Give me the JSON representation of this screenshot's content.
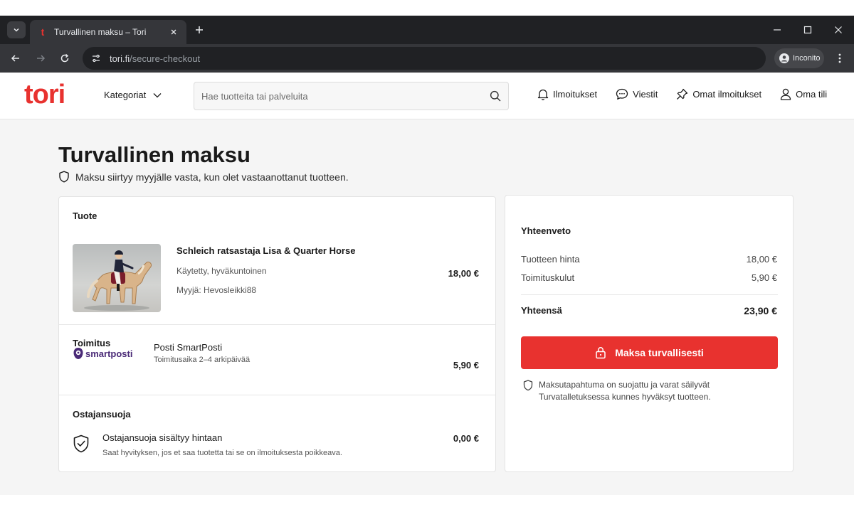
{
  "browser": {
    "tab_title": "Turvallinen maksu – Tori",
    "favicon_letter": "t",
    "url_host": "tori.fi",
    "url_path": "/secure-checkout",
    "profile_label": "Inconito"
  },
  "header": {
    "logo": "tori",
    "categories_label": "Kategoriat",
    "search_placeholder": "Hae tuotteita tai palveluita",
    "links": {
      "notifications": "Ilmoitukset",
      "messages": "Viestit",
      "my_listings": "Omat ilmoitukset",
      "account": "Oma tili"
    }
  },
  "page": {
    "title": "Turvallinen maksu",
    "subtitle": "Maksu siirtyy myyjälle vasta, kun olet vastaanottanut tuotteen."
  },
  "product": {
    "section_title": "Tuote",
    "name": "Schleich ratsastaja Lisa & Quarter Horse",
    "condition": "Käytetty, hyväkuntoinen",
    "seller": "Myyjä: Hevosleikki88",
    "price": "18,00 €"
  },
  "delivery": {
    "section_title": "Toimitus",
    "provider_logo": "smartposti",
    "name": "Posti SmartPosti",
    "time": "Toimitusaika 2–4 arkipäivää",
    "price": "5,90 €"
  },
  "protection": {
    "section_title": "Ostajansuoja",
    "title": "Ostajansuoja sisältyy hintaan",
    "description": "Saat hyvityksen, jos et saa tuotetta tai se on ilmoituksesta poikkeava.",
    "price": "0,00 €"
  },
  "summary": {
    "title": "Yhteenveto",
    "product_price_label": "Tuotteen hinta",
    "product_price_value": "18,00 €",
    "shipping_label": "Toimituskulut",
    "shipping_value": "5,90 €",
    "total_label": "Yhteensä",
    "total_value": "23,90 €",
    "pay_button": "Maksa turvallisesti",
    "secure_note_line1": "Maksutapahtuma on suojattu ja varat säilyvät",
    "secure_note_line2": "Turvatalletuksessa kunnes hyväksyt tuotteen."
  },
  "colors": {
    "brand": "#e8322f",
    "smartposti": "#4a2a77"
  }
}
